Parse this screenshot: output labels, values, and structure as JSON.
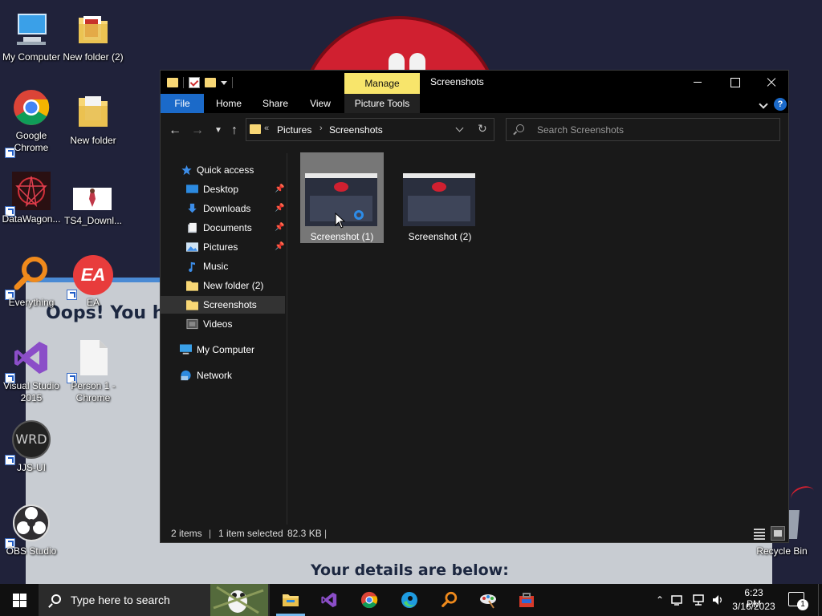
{
  "desktop": {
    "wallpaper": {
      "oops_text": "Oops! You ha",
      "details_text": "Your details are below:"
    },
    "icons": [
      {
        "label": "My Computer",
        "icon": "computer-icon"
      },
      {
        "label": "New folder (2)",
        "icon": "folder-icon"
      },
      {
        "label": "Google Chrome",
        "icon": "chrome-icon"
      },
      {
        "label": "New folder",
        "icon": "folder-icon"
      },
      {
        "label": "DataWagon...",
        "icon": "datawagon-icon"
      },
      {
        "label": "TS4_Downl...",
        "icon": "image-file-icon"
      },
      {
        "label": "Everything",
        "icon": "everything-search-icon"
      },
      {
        "label": "EA",
        "icon": "ea-icon"
      },
      {
        "label": "Visual Studio 2015",
        "icon": "visual-studio-icon"
      },
      {
        "label": "Person 1 - Chrome",
        "icon": "file-icon"
      },
      {
        "label": "JJS-UI",
        "icon": "wrd-icon"
      },
      {
        "label": "OBS Studio",
        "icon": "obs-icon"
      },
      {
        "label": "Recycle Bin",
        "icon": "recycle-bin-icon"
      }
    ]
  },
  "explorer": {
    "title": "Screenshots",
    "contextual_tab": "Manage",
    "ribbon_tabs": {
      "file": "File",
      "home": "Home",
      "share": "Share",
      "view": "View",
      "picture_tools": "Picture Tools"
    },
    "address": {
      "more": "«",
      "crumbs": [
        "Pictures",
        "Screenshots"
      ],
      "separator": "›"
    },
    "search": {
      "placeholder": "Search Screenshots",
      "value": ""
    },
    "nav": [
      {
        "label": "Quick access",
        "icon": "star-icon",
        "pinned": false,
        "selected": false
      },
      {
        "label": "Desktop",
        "icon": "desktop-icon",
        "pinned": true,
        "selected": false
      },
      {
        "label": "Downloads",
        "icon": "download-icon",
        "pinned": true,
        "selected": false
      },
      {
        "label": "Documents",
        "icon": "documents-icon",
        "pinned": true,
        "selected": false
      },
      {
        "label": "Pictures",
        "icon": "pictures-icon",
        "pinned": true,
        "selected": false
      },
      {
        "label": "Music",
        "icon": "music-icon",
        "pinned": false,
        "selected": false
      },
      {
        "label": "New folder (2)",
        "icon": "folder-icon",
        "pinned": false,
        "selected": false
      },
      {
        "label": "Screenshots",
        "icon": "folder-icon",
        "pinned": false,
        "selected": true
      },
      {
        "label": "Videos",
        "icon": "videos-icon",
        "pinned": false,
        "selected": false
      },
      {
        "label": "My Computer",
        "icon": "computer-icon",
        "pinned": false,
        "selected": false
      },
      {
        "label": "Network",
        "icon": "network-icon",
        "pinned": false,
        "selected": false
      }
    ],
    "files": [
      {
        "name": "Screenshot (1)",
        "selected": true
      },
      {
        "name": "Screenshot (2)",
        "selected": false
      }
    ],
    "status": {
      "count": "2 items",
      "selection": "1 item selected",
      "size": "82.3 KB",
      "sep": "|"
    }
  },
  "taskbar": {
    "search_placeholder": "Type here to search",
    "apps": [
      {
        "name": "file-explorer",
        "active": true
      },
      {
        "name": "visual-studio",
        "active": false
      },
      {
        "name": "chrome",
        "active": false
      },
      {
        "name": "edge",
        "active": false
      },
      {
        "name": "everything",
        "active": false
      },
      {
        "name": "paint",
        "active": false
      },
      {
        "name": "toolbox",
        "active": false
      }
    ],
    "clock": {
      "time": "6:23 PM",
      "date": "3/16/2023"
    },
    "notifications": "1"
  },
  "colors": {
    "accent": "#1b6ac9",
    "manage_tab": "#f8e56b",
    "folder": "#f8d775",
    "window_bg": "#191919",
    "taskbar_bg": "#101010"
  }
}
